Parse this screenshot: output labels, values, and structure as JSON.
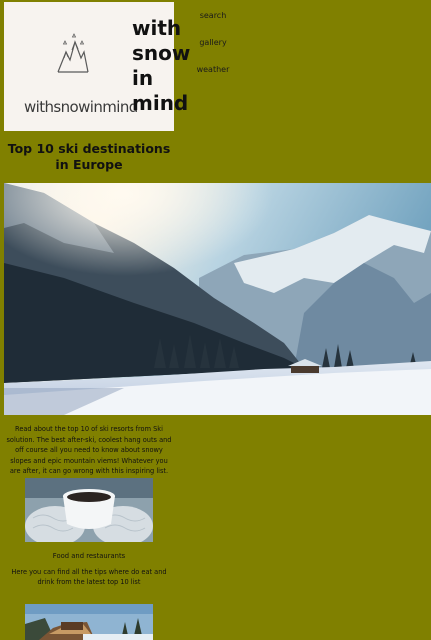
{
  "header": {
    "logo_text": "withsnowinmind",
    "site_title_lines": [
      "with",
      "snow",
      "in",
      "mind"
    ]
  },
  "nav": {
    "items": [
      "search",
      "gallery",
      "weather"
    ]
  },
  "main": {
    "heading": "Top 10 ski destinations in Europe",
    "hero_icon": "snowy-mountain-valley-photo",
    "intro": "Read about the top 10 of ski resorts from Ski solution. The best after-ski, coolest hang outs and off course all you need to know about snowy slopes and epic mountain viems! Whatever you are after, it can go wrong with this inspiring list.",
    "cards": [
      {
        "image_icon": "hot-drink-in-mittens-photo",
        "title": "Food and restaurants",
        "description": "Here you can find all the tips where do eat and drink from the latest top 10 list"
      },
      {
        "image_icon": "wooden-cabin-sign-photo"
      }
    ]
  }
}
